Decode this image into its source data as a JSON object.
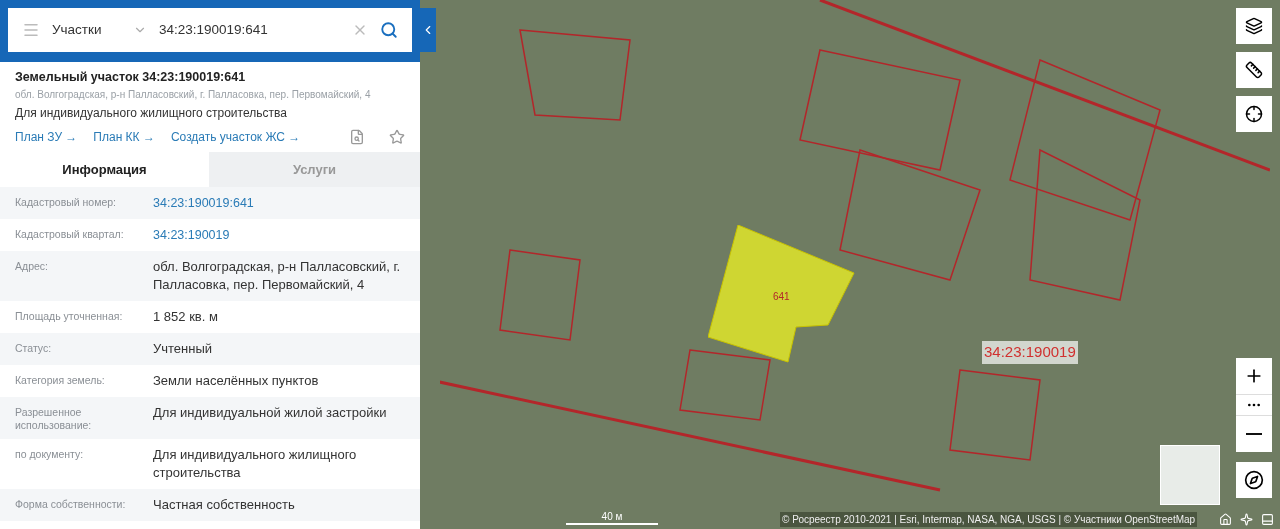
{
  "search": {
    "category": "Участки",
    "value": "34:23:190019:641"
  },
  "object": {
    "title": "Земельный участок 34:23:190019:641",
    "address": "обл. Волгоградская, р-н Палласовский, г. Палласовка, пер. Первомайский, 4",
    "purpose": "Для индивидуального жилищного строительства",
    "links": [
      "План ЗУ →",
      "План КК →",
      "Создать участок ЖС →"
    ]
  },
  "tabs": [
    {
      "label": "Информация",
      "selected": true
    },
    {
      "label": "Услуги",
      "selected": false
    }
  ],
  "rows": [
    {
      "label": "Кадастровый номер:",
      "value": "34:23:190019:641",
      "kind": "link"
    },
    {
      "label": "Кадастровый квартал:",
      "value": "34:23:190019",
      "kind": "link"
    },
    {
      "label": "Адрес:",
      "value": "обл. Волгоградская, р-н Палласовский, г. Палласовка, пер. Первомайский, 4",
      "kind": "text"
    },
    {
      "label": "Площадь уточненная:",
      "value": "1 852 кв. м",
      "kind": "text"
    },
    {
      "label": "Статус:",
      "value": "Учтенный",
      "kind": "text"
    },
    {
      "label": "Категория земель:",
      "value": "Земли населённых пунктов",
      "kind": "text"
    },
    {
      "label": "Разрешенное использование:",
      "value": "Для индивидуальной жилой застройки",
      "kind": "text"
    },
    {
      "label": "по документу:",
      "value": "Для индивидуального жилищного строительства",
      "kind": "text"
    },
    {
      "label": "Форма собственности:",
      "value": "Частная собственность",
      "kind": "text"
    }
  ],
  "map": {
    "parcel_label": "641",
    "quarter_label": "34:23:190019",
    "scale": "40 м",
    "attribution": "© Росреестр 2010-2021 | Esri, Intermap, NASA, NGA, USGS | © Участники OpenStreetMap"
  }
}
